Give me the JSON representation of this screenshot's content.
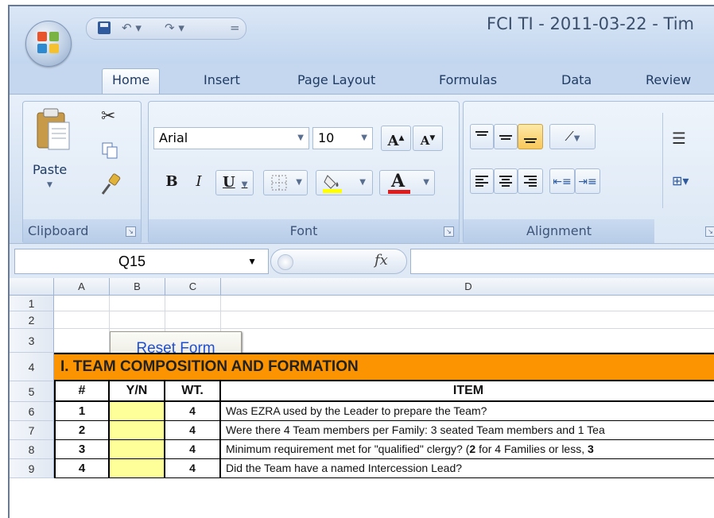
{
  "window": {
    "title": "FCI TI - 2011-03-22 - Tim"
  },
  "quick_access": {
    "undo": "↶ ▾",
    "redo": "↷ ▾",
    "customize": "="
  },
  "tabs": [
    "Home",
    "Insert",
    "Page Layout",
    "Formulas",
    "Data",
    "Review"
  ],
  "ribbon": {
    "clipboard": {
      "label": "Clipboard",
      "paste": "Paste"
    },
    "font": {
      "label": "Font",
      "font_name": "Arial",
      "font_size": "10",
      "grow": "A",
      "shrink": "A",
      "bold": "B",
      "italic": "I",
      "underline": "U",
      "font_color_letter": "A"
    },
    "alignment": {
      "label": "Alignment"
    }
  },
  "formula_bar": {
    "name_box": "Q15",
    "fx": "fx",
    "formula": ""
  },
  "columns": [
    "A",
    "B",
    "C",
    "D"
  ],
  "rows": [
    "1",
    "2",
    "3",
    "4",
    "5",
    "6",
    "7",
    "8",
    "9"
  ],
  "reset_button": "Reset Form",
  "section": {
    "title": "I.  TEAM COMPOSITION AND FORMATION"
  },
  "table_headers": {
    "num": "#",
    "yn": "Y/N",
    "wt": "WT.",
    "item": "ITEM"
  },
  "table_rows": [
    {
      "num": "1",
      "wt": "4",
      "item": "Was EZRA used by the Leader to prepare the Team?"
    },
    {
      "num": "2",
      "wt": "4",
      "item": "Were there 4 Team members per Family: 3 seated Team members and 1 Tea"
    },
    {
      "num": "3",
      "wt": "4",
      "item_start": "Minimum requirement met for \"qualified\" clergy? (",
      "item_b1": "2",
      "item_mid": " for 4 Families or less, ",
      "item_b2": "3"
    },
    {
      "num": "4",
      "wt": "4",
      "item": "Did the Team have a named Intercession Lead?"
    }
  ],
  "colors": {
    "banner": "#fb9400",
    "yn_fill": "#ffff99",
    "ribbon": "#d6e3f3"
  }
}
